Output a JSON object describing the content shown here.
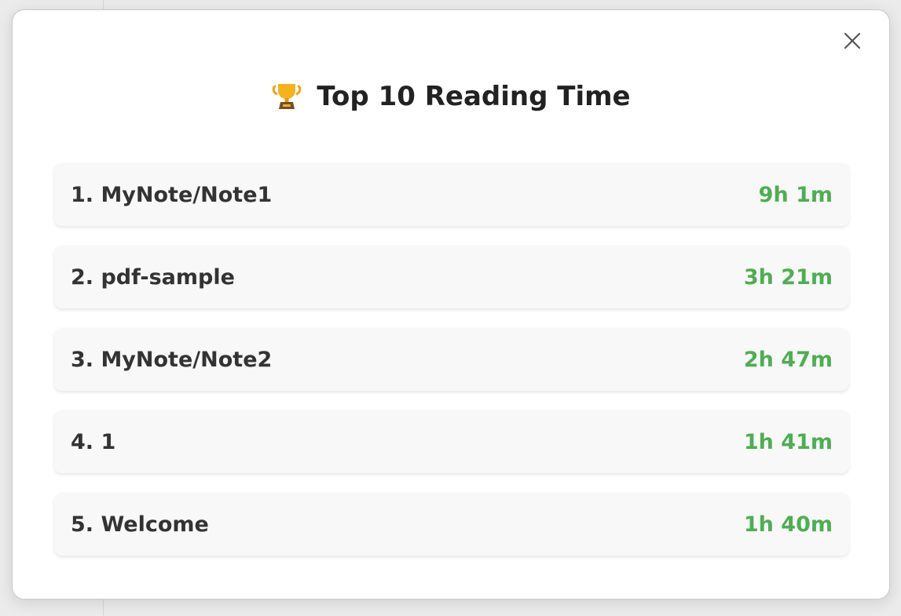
{
  "modal": {
    "title": "Top 10 Reading Time",
    "title_icon": "trophy-icon",
    "close_icon": "close-icon"
  },
  "ranking": [
    {
      "label": "1. MyNote/Note1",
      "time": "9h 1m"
    },
    {
      "label": "2. pdf-sample",
      "time": "3h 21m"
    },
    {
      "label": "3. MyNote/Note2",
      "time": "2h 47m"
    },
    {
      "label": "4. 1",
      "time": "1h 41m"
    },
    {
      "label": "5. Welcome",
      "time": "1h 40m"
    }
  ],
  "colors": {
    "time_accent": "#4caf50",
    "title_text": "#222222",
    "row_text": "#333333",
    "row_background": "#f8f8f8"
  }
}
